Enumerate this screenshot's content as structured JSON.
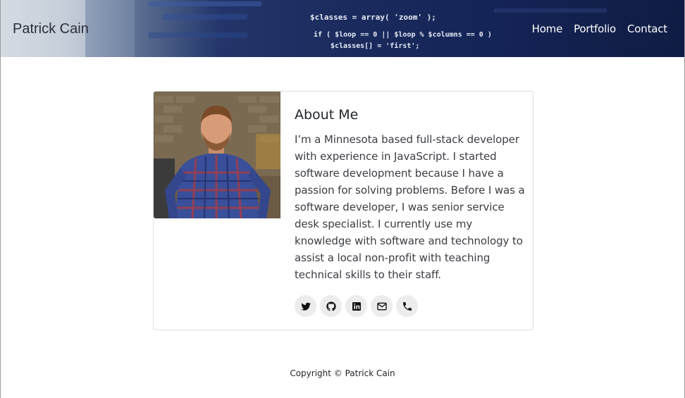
{
  "navbar": {
    "brand": "Patrick Cain",
    "links": [
      {
        "label": "Home"
      },
      {
        "label": "Portfolio"
      },
      {
        "label": "Contact"
      }
    ],
    "code_lines": [
      "$classes = array( 'zoom' );",
      "if ( $loop == 0 || $loop % $columns == 0 )",
      "$classes[] = 'first';"
    ]
  },
  "about": {
    "title": "About Me",
    "text": "I’m a Minnesota based full-stack developer with experience in JavaScript. I started software development because I have a passion for solving problems. Before I was a software developer, I was senior service desk specialist. I currently use my knowledge with software and technology to assist a local non-profit with teaching technical skills to their staff.",
    "socials": [
      {
        "icon": "twitter-icon"
      },
      {
        "icon": "github-icon"
      },
      {
        "icon": "linkedin-icon"
      },
      {
        "icon": "envelope-icon"
      },
      {
        "icon": "phone-icon"
      }
    ]
  },
  "footer": {
    "copyright": "Copyright © Patrick Cain"
  },
  "colors": {
    "navbar_dark": "#142456",
    "social_bg": "#ececec",
    "card_border": "#dedede"
  }
}
